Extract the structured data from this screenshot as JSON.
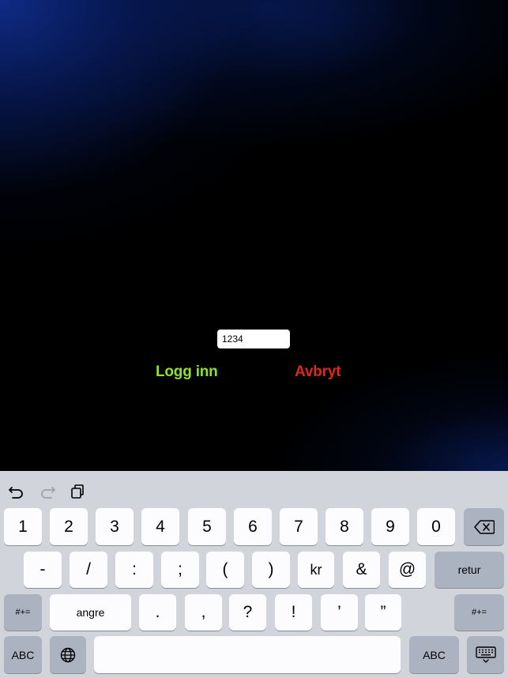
{
  "login_form": {
    "pin_value": "1234",
    "login_label": "Logg inn",
    "cancel_label": "Avbryt",
    "login_color": "#8fe12b",
    "cancel_color": "#e0271c"
  },
  "keyboard": {
    "toolbar_icons": [
      "undo-icon",
      "redo-icon",
      "clipboard-icon"
    ],
    "row1": [
      "1",
      "2",
      "3",
      "4",
      "5",
      "6",
      "7",
      "8",
      "9",
      "0"
    ],
    "row2": [
      "-",
      "/",
      ":",
      ";",
      "(",
      ")",
      "kr",
      "&",
      "@"
    ],
    "return_label": "retur",
    "symbols_label": "#+=",
    "undo_label": "angre",
    "row3": [
      ".",
      ",",
      "?",
      "!",
      "’",
      "”"
    ],
    "abc_label": "ABC"
  }
}
